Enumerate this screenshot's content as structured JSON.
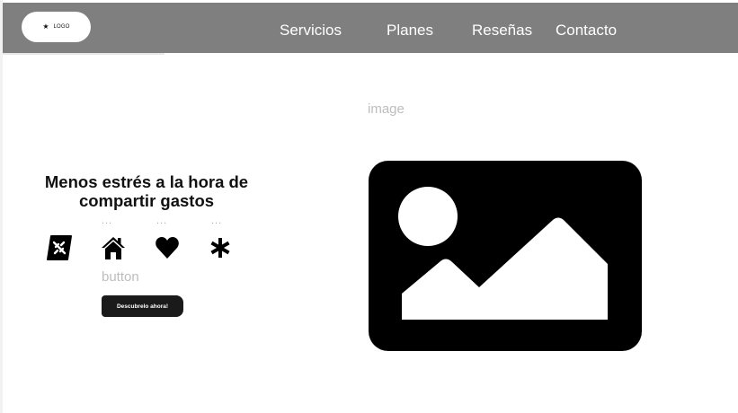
{
  "header": {
    "logo_text": "LOGO",
    "nav": [
      "Servicios",
      "Planes",
      "Reseñas",
      "Contacto"
    ]
  },
  "hero": {
    "heading": "Menos estrés a la hora de compartir gastos",
    "features": [
      {
        "label": "...",
        "icon": "broken-link-icon"
      },
      {
        "label": "...",
        "icon": "home-icon"
      },
      {
        "label": "...",
        "icon": "heart-icon"
      },
      {
        "label": "...",
        "icon": "asterisk-icon"
      }
    ],
    "button_placeholder": "button",
    "cta_label": "Descubrelo ahora!"
  },
  "media": {
    "placeholder": "image",
    "icon": "image-placeholder-icon"
  },
  "colors": {
    "header_bg": "#7f7f7f",
    "nav_text": "#ffffff",
    "cta_bg": "#1a1a1a",
    "placeholder_text": "#bdbdbd"
  }
}
